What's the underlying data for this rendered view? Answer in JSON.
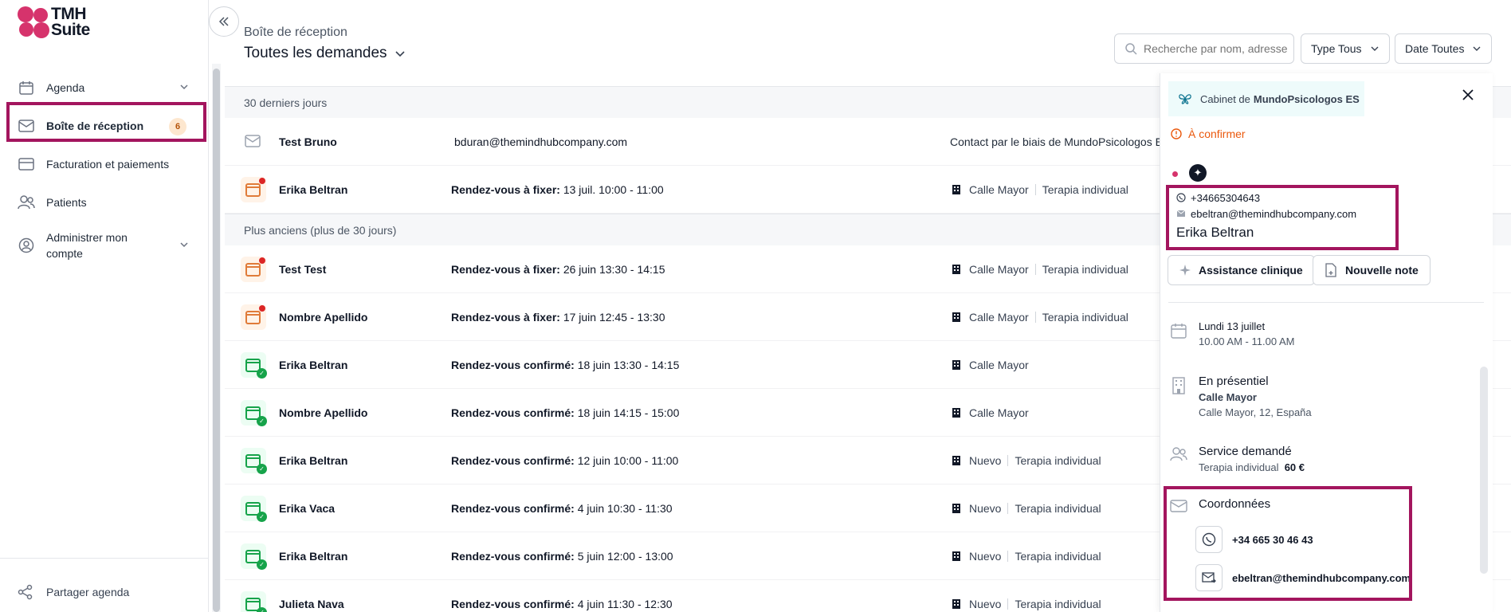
{
  "logo": {
    "line1": "TMH",
    "line2": "Suite"
  },
  "sidebar": {
    "items": [
      {
        "label": "Agenda",
        "icon": "calendar-icon"
      },
      {
        "label": "Boîte de réception",
        "icon": "mail-icon",
        "badge": "6"
      },
      {
        "label": "Facturation et paiements",
        "icon": "card-icon"
      },
      {
        "label": "Patients",
        "icon": "users-icon"
      },
      {
        "label": "Administrer mon",
        "label2": "compte",
        "icon": "user-circle-icon"
      }
    ],
    "footer": "Partager agenda"
  },
  "header": {
    "subtitle": "Boîte de réception",
    "title": "Toutes les demandes",
    "search_placeholder": "Recherche par nom, adresse e",
    "filter_type": "Type Tous",
    "filter_date": "Date Toutes"
  },
  "sections": {
    "recent": "30 derniers jours",
    "older": "Plus anciens (plus de 30 jours)"
  },
  "rows": [
    {
      "name": "Test Bruno",
      "email": "bduran@themindhubcompany.com",
      "extra": "Contact par le biais de MundoPsicologos ES"
    },
    {
      "name": "Erika Beltran",
      "label": "Rendez-vous à fixer:",
      "time": "13 juil. 10:00 - 11:00",
      "loc": "Calle Mayor",
      "svc": "Terapia individual"
    },
    {
      "name": "Test Test",
      "label": "Rendez-vous à fixer:",
      "time": "26 juin 13:30 - 14:15",
      "loc": "Calle Mayor",
      "svc": "Terapia individual"
    },
    {
      "name": "Nombre Apellido",
      "label": "Rendez-vous à fixer:",
      "time": "17 juin 12:45 - 13:30",
      "loc": "Calle Mayor",
      "svc": "Terapia individual"
    },
    {
      "name": "Erika Beltran",
      "label": "Rendez-vous confirmé:",
      "time": "18 juin 13:30 - 14:15",
      "loc": "Calle Mayor"
    },
    {
      "name": "Nombre Apellido",
      "label": "Rendez-vous confirmé:",
      "time": "18 juin 14:15 - 15:00",
      "loc": "Calle Mayor"
    },
    {
      "name": "Erika Beltran",
      "label": "Rendez-vous confirmé:",
      "time": "12 juin 10:00 - 11:00",
      "loc": "Nuevo",
      "svc": "Terapia individual"
    },
    {
      "name": "Erika Vaca",
      "label": "Rendez-vous confirmé:",
      "time": "4 juin 10:30 - 11:30",
      "loc": "Nuevo",
      "svc": "Terapia individual"
    },
    {
      "name": "Erika Beltran",
      "label": "Rendez-vous confirmé:",
      "time": "5 juin 12:00 - 13:00",
      "loc": "Nuevo",
      "svc": "Terapia individual"
    },
    {
      "name": "Julieta Nava",
      "label": "Rendez-vous confirmé:",
      "time": "4 juin 11:30 - 12:30",
      "loc": "Nuevo",
      "svc": "Terapia individual"
    }
  ],
  "panel": {
    "cabinet_prefix": "Cabinet de",
    "cabinet_name": "MundoPsicologos ES",
    "status": "À confirmer",
    "phone": "+34665304643",
    "email": "ebeltran@themindhubcompany.com",
    "name": "Erika Beltran",
    "btn_ai": "Assistance clinique",
    "btn_note": "Nouvelle note",
    "date": "Lundi 13 juillet",
    "time": "10.00 AM - 11.00 AM",
    "mode": "En présentiel",
    "place": "Calle Mayor",
    "address": "Calle Mayor, 12, España",
    "service_title": "Service demandé",
    "service": "Terapia individual",
    "price": "60 €",
    "coord_title": "Coordonnées",
    "coord_phone": "+34 665 30 46 43",
    "coord_email": "ebeltran@themindhubcompany.com"
  },
  "colors": {
    "brand": "#d6336c",
    "highlight": "#a3155e",
    "warning": "#ea580c",
    "success": "#16a34a"
  }
}
